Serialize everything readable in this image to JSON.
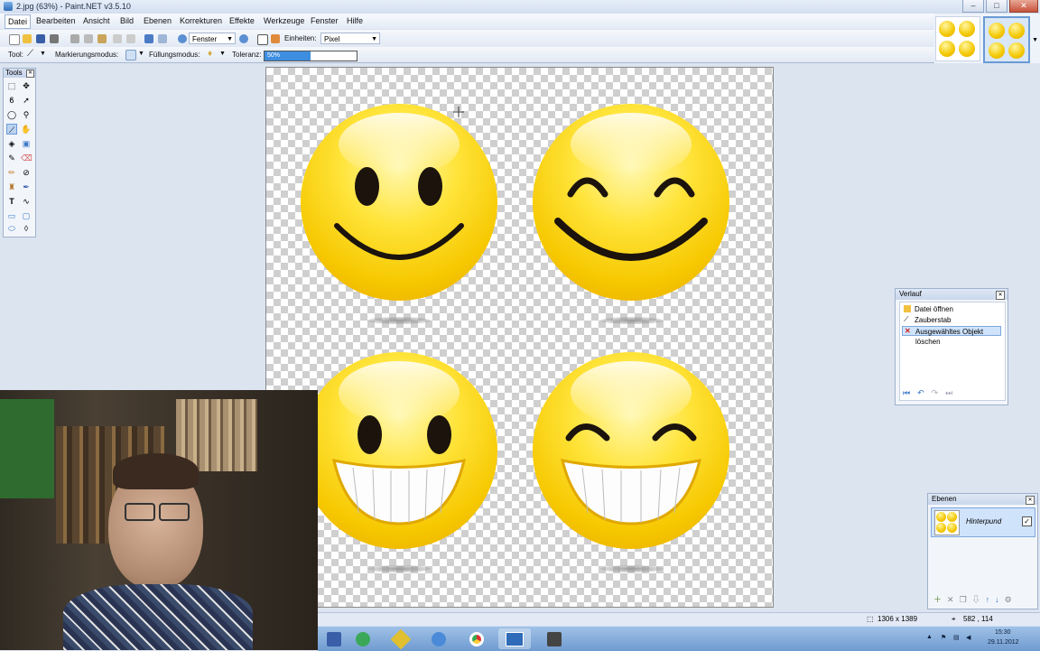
{
  "window": {
    "title": "2.jpg (63%) - Paint.NET v3.5.10"
  },
  "menu": [
    "Datei",
    "Bearbeiten",
    "Ansicht",
    "Bild",
    "Ebenen",
    "Korrekturen",
    "Effekte",
    "Werkzeuge",
    "Fenster",
    "Hilfe"
  ],
  "toolbar": {
    "zoom_mode": "Fenster",
    "units_label": "Einheiten:",
    "units_value": "Pixel",
    "tool_label": "Tool:",
    "selection_mode_label": "Markierungsmodus:",
    "fill_mode_label": "Füllungsmodus:",
    "tolerance_label": "Toleranz:",
    "tolerance_value": "50%",
    "tolerance_fraction": 0.5
  },
  "tools_panel": {
    "title": "Tools"
  },
  "history_panel": {
    "title": "Verlauf",
    "items": [
      "Datei öffnen",
      "Zauberstab",
      "Ausgewähltes Objekt löschen"
    ],
    "selected_index": 2
  },
  "layers_panel": {
    "title": "Ebenen",
    "layers": [
      {
        "name": "Hinterpund",
        "visible": true
      }
    ]
  },
  "status": {
    "image_size": "1306 x 1389",
    "cursor_pos": "582 , 114"
  },
  "tray": {
    "time": "15:30",
    "date": "29.11.2012"
  },
  "colors": {
    "accent": "#6a9ad4",
    "smiley": "#f6c800"
  }
}
